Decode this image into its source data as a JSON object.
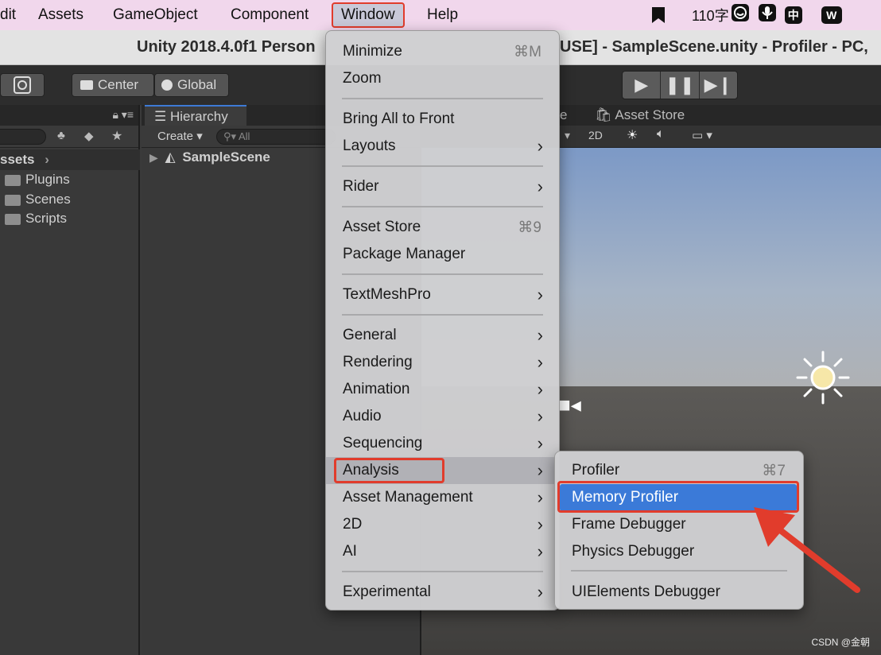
{
  "menubar": {
    "items": [
      "dit",
      "Assets",
      "GameObject",
      "Component",
      "Window",
      "Help"
    ],
    "tray_count": "110字",
    "tray_icons": [
      "bookmark-icon",
      "smile-icon",
      "mic-icon",
      "input-zh-icon",
      "wps-icon"
    ],
    "zh_label": "中",
    "wps_label": "W"
  },
  "titlebar": {
    "title_left": "Unity 2018.4.0f1 Person",
    "title_right": "USE] - SampleScene.unity - Profiler - PC,"
  },
  "toolbar": {
    "center_label": "Center",
    "global_label": "Global"
  },
  "project": {
    "assets_label": "ssets",
    "folders": [
      "Plugins",
      "Scenes",
      "Scripts"
    ]
  },
  "hierarchy": {
    "tab_label": "Hierarchy",
    "create_label": "Create",
    "search_placeholder": "All",
    "scene_name": "SampleScene"
  },
  "scene": {
    "tab_partial": "e",
    "asset_store_tab": "Asset Store",
    "mode_2d": "2D"
  },
  "window_menu": {
    "items": [
      {
        "label": "Minimize",
        "shortcut": "⌘M"
      },
      {
        "label": "Zoom"
      },
      {
        "label": "Bring All to Front"
      },
      {
        "label": "Layouts",
        "arrow": "›"
      },
      {
        "label": "Rider",
        "arrow": "›"
      },
      {
        "label": "Asset Store",
        "shortcut": "⌘9"
      },
      {
        "label": "Package Manager"
      },
      {
        "label": "TextMeshPro",
        "arrow": "›"
      },
      {
        "label": "General",
        "arrow": "›"
      },
      {
        "label": "Rendering",
        "arrow": "›"
      },
      {
        "label": "Animation",
        "arrow": "›"
      },
      {
        "label": "Audio",
        "arrow": "›"
      },
      {
        "label": "Sequencing",
        "arrow": "›"
      },
      {
        "label": "Analysis",
        "arrow": "›"
      },
      {
        "label": "Asset Management",
        "arrow": "›"
      },
      {
        "label": "2D",
        "arrow": "›"
      },
      {
        "label": "AI",
        "arrow": "›"
      },
      {
        "label": "Experimental",
        "arrow": "›"
      }
    ]
  },
  "analysis_menu": {
    "items": [
      {
        "label": "Profiler",
        "shortcut": "⌘7"
      },
      {
        "label": "Memory Profiler"
      },
      {
        "label": "Frame Debugger"
      },
      {
        "label": "Physics Debugger"
      },
      {
        "label": "UIElements Debugger"
      }
    ]
  },
  "watermark": "CSDN @金朝",
  "colors": {
    "highlight": "#e13c2c",
    "selection": "#3b7ad8",
    "menubar_bg": "#f1d7ec"
  }
}
